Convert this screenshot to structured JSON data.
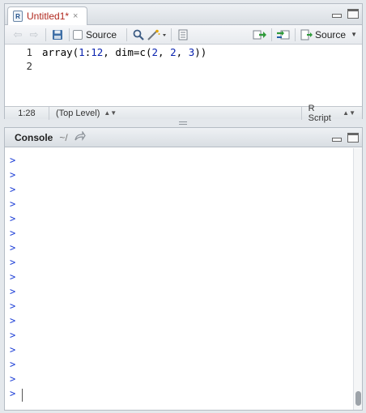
{
  "editor": {
    "tab": {
      "label": "Untitled1*",
      "close_glyph": "×",
      "icon_letter": "R"
    },
    "toolbar": {
      "source_on_save_label": "Source",
      "source_button_label": "Source"
    },
    "gutter": [
      "1",
      "2"
    ],
    "code": {
      "prefix": "array(",
      "n1": "1",
      "sep1": ":",
      "n2": "12",
      "mid": ", dim=c(",
      "n3": "2",
      "sep2": ", ",
      "n4": "2",
      "sep3": ", ",
      "n5": "3",
      "suffix": "))"
    },
    "status": {
      "position": "1:28",
      "scope": "(Top Level)",
      "filetype": "R Script"
    }
  },
  "console": {
    "title": "Console",
    "path": "~/",
    "prompt_glyph": ">",
    "prompt_count": 17
  },
  "colors": {
    "tab_text": "#b0281e",
    "number": "#0b24b0",
    "prompt": "#1a3cd6"
  }
}
